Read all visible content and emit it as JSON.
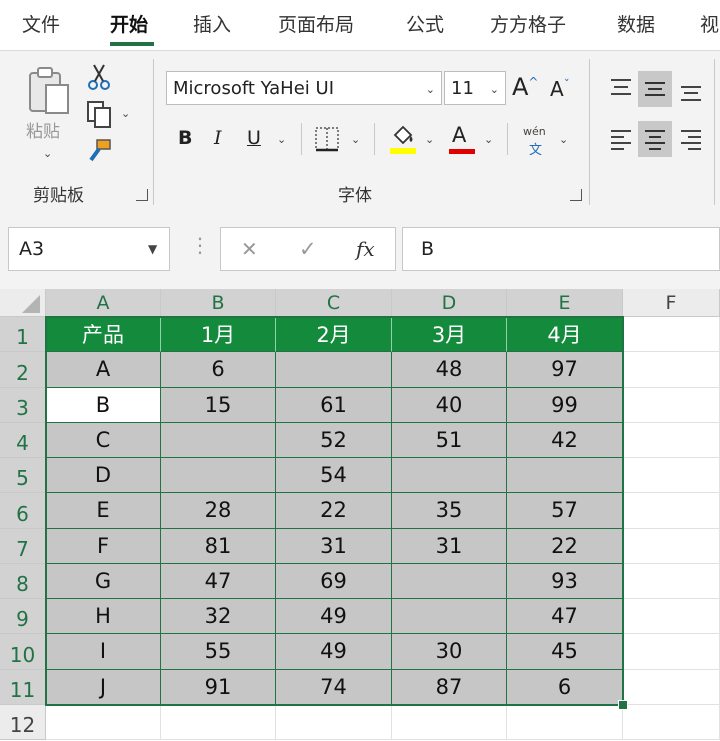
{
  "ribbon_tabs": [
    "文件",
    "开始",
    "插入",
    "页面布局",
    "公式",
    "方方格子",
    "数据",
    "视"
  ],
  "active_tab": "开始",
  "clipboard": {
    "paste_label": "粘贴",
    "group_label": "剪贴板"
  },
  "font": {
    "name": "Microsoft YaHei UI",
    "size": "11",
    "group_label": "字体",
    "grow_label": "A",
    "shrink_label": "A",
    "bold": "B",
    "italic": "I",
    "underline": "U",
    "font_color_label": "A",
    "phonetic_top": "wén",
    "phonetic_bottom": "文",
    "fill_color": "#ffff00",
    "font_color": "#e00000"
  },
  "formula_bar": {
    "name_box": "A3",
    "cancel_symbol": "✕",
    "enter_symbol": "✓",
    "fx_label": "fx",
    "content": "B"
  },
  "sheet": {
    "columns": [
      "A",
      "B",
      "C",
      "D",
      "E",
      "F"
    ],
    "rows": [
      "1",
      "2",
      "3",
      "4",
      "5",
      "6",
      "7",
      "8",
      "9",
      "10",
      "11",
      "12"
    ],
    "header_row": [
      "产品",
      "1月",
      "2月",
      "3月",
      "4月"
    ],
    "data": [
      [
        "A",
        "6",
        "",
        "48",
        "97"
      ],
      [
        "B",
        "15",
        "61",
        "40",
        "99"
      ],
      [
        "C",
        "",
        "52",
        "51",
        "42"
      ],
      [
        "D",
        "",
        "54",
        "",
        ""
      ],
      [
        "E",
        "28",
        "22",
        "35",
        "57"
      ],
      [
        "F",
        "81",
        "31",
        "31",
        "22"
      ],
      [
        "G",
        "47",
        "69",
        "",
        "93"
      ],
      [
        "H",
        "32",
        "49",
        "",
        "47"
      ],
      [
        "I",
        "55",
        "49",
        "30",
        "45"
      ],
      [
        "J",
        "91",
        "74",
        "87",
        "6"
      ]
    ],
    "active_cell": "A3",
    "accent_color": "#217346",
    "header_fill": "#138a3c",
    "selection_fill": "#c6c6c6"
  }
}
